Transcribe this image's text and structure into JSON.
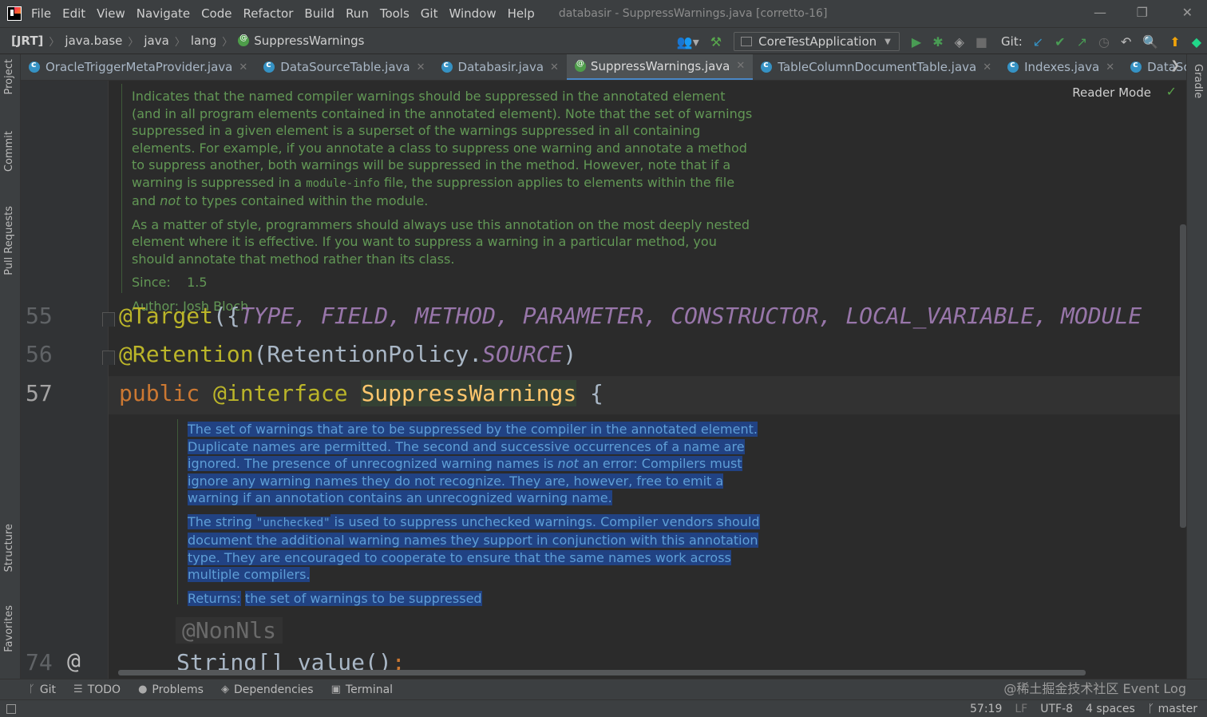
{
  "menubar": {
    "items": [
      "File",
      "Edit",
      "View",
      "Navigate",
      "Code",
      "Refactor",
      "Build",
      "Run",
      "Tools",
      "Git",
      "Window",
      "Help"
    ],
    "window_title": "databasir - SuppressWarnings.java [corretto-16]"
  },
  "navbar": {
    "breadcrumbs": [
      "[JRT]",
      "java.base",
      "java",
      "lang",
      "SuppressWarnings"
    ],
    "run_config": "CoreTestApplication",
    "git_label": "Git:"
  },
  "tabs": [
    {
      "label": "OracleTriggerMetaProvider.java",
      "active": false
    },
    {
      "label": "DataSourceTable.java",
      "active": false
    },
    {
      "label": "Databasir.java",
      "active": false
    },
    {
      "label": "SuppressWarnings.java",
      "active": true
    },
    {
      "label": "TableColumnDocumentTable.java",
      "active": false
    },
    {
      "label": "Indexes.java",
      "active": false
    },
    {
      "label": "DataSourcePrope",
      "active": false
    }
  ],
  "left_tools": [
    "Project",
    "Commit",
    "Pull Requests",
    "Structure",
    "Favorites"
  ],
  "right_tools": [
    "Gradle"
  ],
  "editor": {
    "reader_mode": "Reader Mode",
    "doc_top": {
      "p1_a": "Indicates that the named compiler warnings should be suppressed in the annotated element (and in all program elements contained in the annotated element). Note that the set of warnings suppressed in a given element is a superset of the warnings suppressed in all containing elements. For example, if you annotate a class to suppress one warning and annotate a method to suppress another, both warnings will be suppressed in the method. However, note that if a warning is suppressed in a ",
      "p1_code": "module-info",
      "p1_b": " file, the suppression applies to elements within the file and ",
      "p1_em": "not",
      "p1_c": " to types contained within the module.",
      "p2": "As a matter of style, programmers should always use this annotation on the most deeply nested element where it is effective. If you want to suppress a warning in a particular method, you should annotate that method rather than its class.",
      "since_label": "Since:",
      "since_value": "1.5",
      "author": "Author: Josh Bloch"
    },
    "lines": {
      "l55_num": "55",
      "l55_ann": "@Target",
      "l55_open": "({",
      "l55_consts": "TYPE, FIELD, METHOD, PARAMETER, CONSTRUCTOR, LOCAL_VARIABLE, MODULE",
      "l56_num": "56",
      "l56_ann": "@Retention",
      "l56_a": "(RetentionPolicy.",
      "l56_const": "SOURCE",
      "l56_b": ")",
      "l57_num": "57",
      "l57_kw1": "public",
      "l57_kw2": "@interface",
      "l57_name": "SuppressWarnings",
      "l57_brace": " {",
      "l74_num": "74",
      "l74_marker": "@",
      "l74_code": "String[] value()",
      "l74_semi": ";",
      "nonnls": "@NonNls"
    },
    "doc_member": {
      "p1_a": "The set of warnings that are to be suppressed by the compiler in the annotated element. Duplicate names are permitted. The second and successive occurrences of a name are ignored. The presence of unrecognized warning names is ",
      "p1_em": "not",
      "p1_b": " an error: Compilers must ignore any warning names they do not recognize. They are, however, free to emit a warning if an annotation contains an unrecognized warning name.",
      "p2_a": "The string ",
      "p2_code": "\"unchecked\"",
      "p2_b": " is used to suppress unchecked warnings. Compiler vendors should document the additional warning names they support in conjunction with this annotation type. They are encouraged to cooperate to ensure that the same names work across multiple compilers.",
      "returns_label": "Returns:",
      "returns_value": "the set of warnings to be suppressed"
    }
  },
  "bottom_tools": [
    "Git",
    "TODO",
    "Problems",
    "Dependencies",
    "Terminal"
  ],
  "watermark": "@稀土掘金技术社区 Event Log",
  "status": {
    "position": "57:19",
    "line_sep": "LF",
    "encoding": "UTF-8",
    "indent": "4 spaces",
    "branch": "master"
  }
}
